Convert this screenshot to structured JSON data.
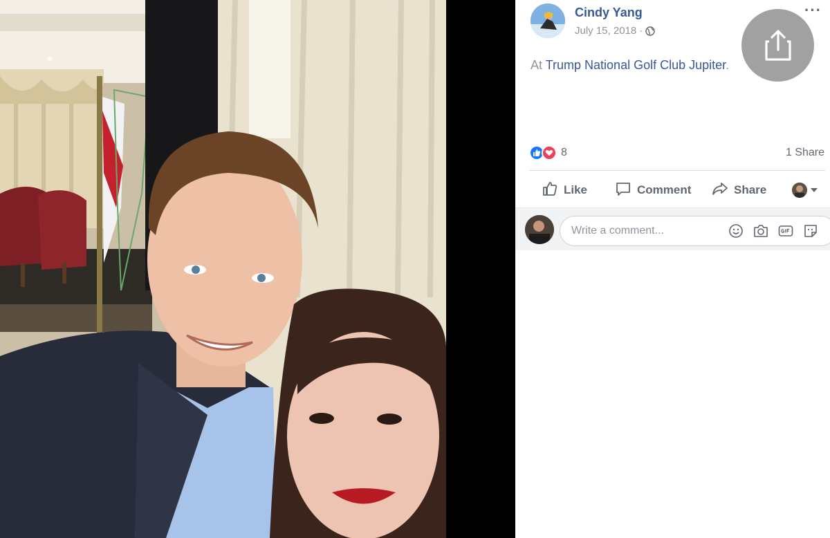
{
  "post": {
    "author": "Cindy Yang",
    "date": "July 15, 2018",
    "meta_separator": "·",
    "more_glyph": "···",
    "checkin_prefix": "At",
    "place": "Trump National Golf Club Jupiter",
    "place_suffix": "."
  },
  "stats": {
    "reaction_count": "8",
    "share_count": "1 Share"
  },
  "actions": {
    "like": "Like",
    "comment": "Comment",
    "share": "Share"
  },
  "comment_box": {
    "placeholder": "Write a comment..."
  },
  "icons": {
    "share_overlay": "share-upload-icon",
    "privacy": "globe-icon",
    "reactions": [
      "like-reaction-icon",
      "love-reaction-icon"
    ],
    "comment_tools": [
      "emoji-icon",
      "camera-icon",
      "gif-icon",
      "sticker-icon"
    ]
  },
  "colors": {
    "link": "#385898",
    "meta": "#90949c",
    "like_blue": "#1877f2",
    "love_red": "#f33e58",
    "action_text": "#606770"
  }
}
